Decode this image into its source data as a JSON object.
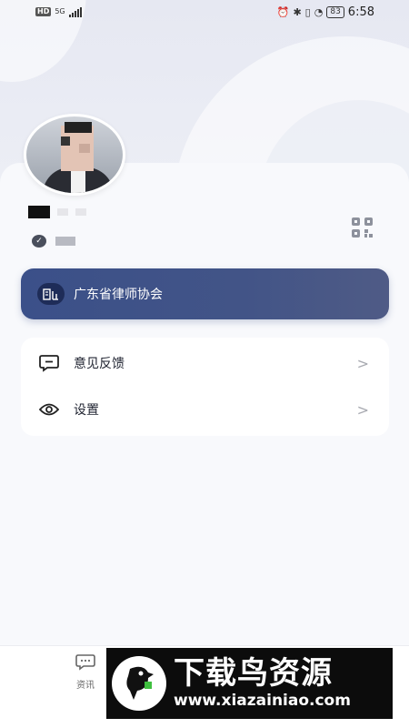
{
  "status_bar": {
    "hd": "HD",
    "network": "5G",
    "battery": "83",
    "time": "6:58"
  },
  "profile": {
    "avatar_icon": "avatar",
    "verified_icon": "check-icon",
    "qr_icon": "qr-code-icon"
  },
  "association": {
    "label": "广东省律师协会",
    "icon": "building-icon"
  },
  "menu": [
    {
      "label": "意见反馈",
      "icon": "feedback-icon"
    },
    {
      "label": "设置",
      "icon": "eye-icon"
    }
  ],
  "bottom_nav": {
    "news_label": "资讯"
  },
  "watermark": {
    "title": "下载鸟资源",
    "url": "www.xiazainiao.com"
  },
  "colors": {
    "accent": "#3b5089",
    "background": "#f3f4f8"
  }
}
